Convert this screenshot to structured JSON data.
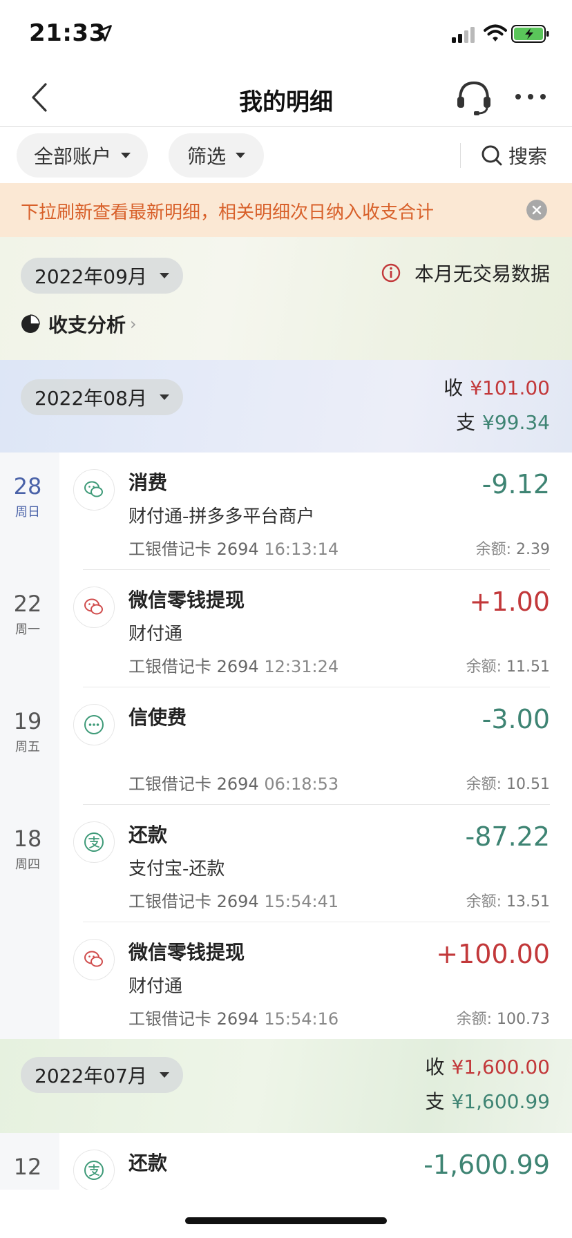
{
  "status_bar": {
    "time": "21:33"
  },
  "nav": {
    "title": "我的明细"
  },
  "filters": {
    "account_label": "全部账户",
    "filter_label": "筛选",
    "search_label": "搜索"
  },
  "notice": {
    "text": "下拉刷新查看最新明细，相关明细次日纳入收支合计"
  },
  "months": [
    {
      "label": "2022年09月",
      "no_data_text": "本月无交易数据",
      "analysis_label": "收支分析"
    },
    {
      "label": "2022年08月",
      "income_label": "收",
      "income": "¥101.00",
      "expense_label": "支",
      "expense": "¥99.34"
    },
    {
      "label": "2022年07月",
      "income_label": "收",
      "income": "¥1,600.00",
      "expense_label": "支",
      "expense": "¥1,600.99"
    }
  ],
  "dates": [
    {
      "day": "28",
      "week": "周日"
    },
    {
      "day": "22",
      "week": "周一"
    },
    {
      "day": "19",
      "week": "周五"
    },
    {
      "day": "18",
      "week": "周四"
    },
    {
      "day": "12"
    }
  ],
  "transactions": [
    {
      "title": "消费",
      "subtitle": "财付通-拼多多平台商户",
      "card": "工银借记卡 2694",
      "time": "16:13:14",
      "amount": "-9.12",
      "balance_label": "余额:",
      "balance": "2.39",
      "icon": "wechat-icon"
    },
    {
      "title": "微信零钱提现",
      "subtitle": "财付通",
      "card": "工银借记卡 2694",
      "time": "12:31:24",
      "amount": "+1.00",
      "balance_label": "余额:",
      "balance": "11.51",
      "icon": "wechat-icon"
    },
    {
      "title": "信使费",
      "subtitle": "",
      "card": "工银借记卡 2694",
      "time": "06:18:53",
      "amount": "-3.00",
      "balance_label": "余额:",
      "balance": "10.51",
      "icon": "more-dots-icon"
    },
    {
      "title": "还款",
      "subtitle": "支付宝-还款",
      "card": "工银借记卡 2694",
      "time": "15:54:41",
      "amount": "-87.22",
      "balance_label": "余额:",
      "balance": "13.51",
      "icon": "alipay-icon"
    },
    {
      "title": "微信零钱提现",
      "subtitle": "财付通",
      "card": "工银借记卡 2694",
      "time": "15:54:16",
      "amount": "+100.00",
      "balance_label": "余额:",
      "balance": "100.73",
      "icon": "wechat-icon"
    },
    {
      "title": "还款",
      "amount": "-1,600.99",
      "icon": "alipay-icon"
    }
  ],
  "colors": {
    "income": "#c2383a",
    "expense": "#3e8473",
    "notice": "#d8602a",
    "active_date": "#4a62a8"
  }
}
